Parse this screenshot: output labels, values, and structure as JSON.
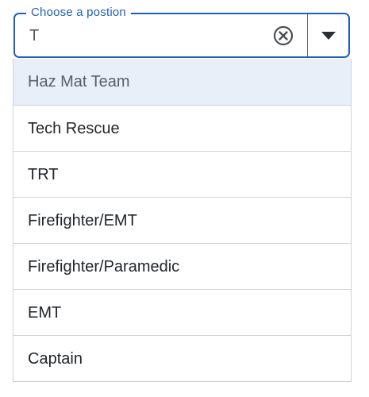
{
  "combobox": {
    "legend": "Choose a postion",
    "value": "T"
  },
  "colors": {
    "accent": "#1f5fb8",
    "highlight_bg": "#e8eff9",
    "border": "#cfd3d7"
  },
  "icons": {
    "clear": "clear-circle-x-icon",
    "toggle": "caret-down-icon"
  },
  "options": [
    {
      "label": "Haz Mat Team",
      "highlighted": true
    },
    {
      "label": "Tech Rescue",
      "highlighted": false
    },
    {
      "label": "TRT",
      "highlighted": false
    },
    {
      "label": "Firefighter/EMT",
      "highlighted": false
    },
    {
      "label": "Firefighter/Paramedic",
      "highlighted": false
    },
    {
      "label": "EMT",
      "highlighted": false
    },
    {
      "label": "Captain",
      "highlighted": false
    }
  ]
}
